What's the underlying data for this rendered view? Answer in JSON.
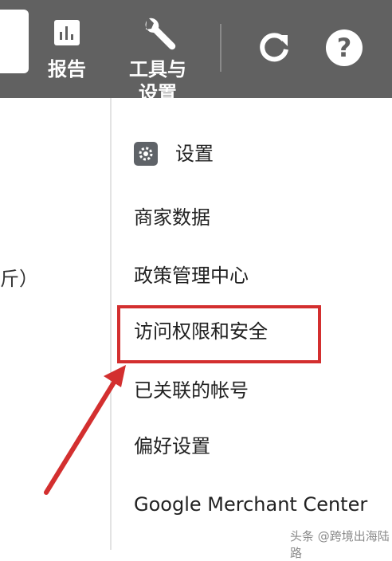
{
  "toolbar": {
    "reports_label": "报告",
    "tools_label": "工具与设置",
    "icons": [
      "bar-chart-icon",
      "wrench-icon",
      "refresh-icon",
      "help-icon"
    ]
  },
  "left_pane": {
    "partial_text": "斤）"
  },
  "menu": {
    "settings_header": "设置",
    "items": [
      "商家数据",
      "政策管理中心",
      "访问权限和安全",
      "已关联的帐号",
      "偏好设置",
      "Google Merchant Center"
    ],
    "highlighted_item": "访问权限和安全"
  },
  "annotation": {
    "color": "#d32f2f"
  },
  "watermark": "头条 @跨境出海陆路"
}
